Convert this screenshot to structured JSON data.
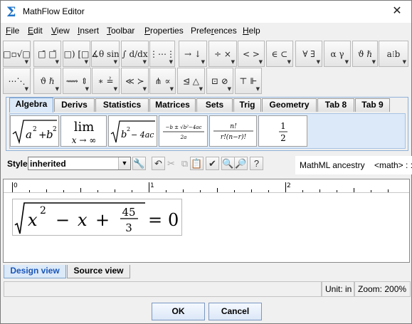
{
  "window": {
    "title": "MathFlow Editor",
    "close_glyph": "✕",
    "app_icon_glyph": "Σ"
  },
  "menu": [
    {
      "pre": "",
      "u": "F",
      "post": "ile"
    },
    {
      "pre": "",
      "u": "E",
      "post": "dit"
    },
    {
      "pre": "",
      "u": "V",
      "post": "iew"
    },
    {
      "pre": "",
      "u": "I",
      "post": "nsert"
    },
    {
      "pre": "",
      "u": "T",
      "post": "oolbar"
    },
    {
      "pre": "",
      "u": "P",
      "post": "roperties"
    },
    {
      "pre": "Prefe",
      "u": "r",
      "post": "ences"
    },
    {
      "pre": "",
      "u": "H",
      "post": "elp"
    }
  ],
  "toolbar_row1": [
    {
      "icon": "script-radical-template-icon",
      "glyph": "□▫√□"
    },
    {
      "icon": "overscript-template-icon",
      "glyph": "□̄ □̃"
    },
    {
      "icon": "fenced-template-icon",
      "glyph": "(□) [□]"
    },
    {
      "icon": "angle-trig-icon",
      "glyph": "∡θ sin"
    },
    {
      "icon": "calculus-icon",
      "glyph": "∫ d/dx"
    },
    {
      "icon": "matrix-template-icon",
      "glyph": "⋮⋯⋮"
    },
    {
      "icon": "arrows-icon",
      "glyph": "→ ↓"
    },
    {
      "icon": "operators-icon",
      "glyph": "÷ ×"
    },
    {
      "icon": "relations-icon",
      "glyph": "< >"
    },
    {
      "icon": "set-operators-icon",
      "glyph": "∈ ⊂"
    },
    {
      "icon": "logic-icon",
      "glyph": "∀ ∃"
    },
    {
      "icon": "greek-icon",
      "glyph": "α γ"
    },
    {
      "icon": "variant-greek-icon",
      "glyph": "ϑ ℏ"
    },
    {
      "icon": "spacing-icon",
      "glyph": "a⁝b"
    }
  ],
  "toolbar_row2": [
    {
      "icon": "dots-icon",
      "glyph": "⋯⋱"
    },
    {
      "icon": "symbols-icon",
      "glyph": "ϑ ℏ"
    },
    {
      "icon": "stretchy-arrows-icon",
      "glyph": "⟿ ⇕"
    },
    {
      "icon": "misc-operators-icon",
      "glyph": "∗ ≟"
    },
    {
      "icon": "comparison-icon",
      "glyph": "≪ ≻"
    },
    {
      "icon": "binary-relations-icon",
      "glyph": "⋔ ∝"
    },
    {
      "icon": "triangle-relations-icon",
      "glyph": "⊴ △"
    },
    {
      "icon": "boxed-operators-icon",
      "glyph": "⊡ ⊘"
    },
    {
      "icon": "tack-icon",
      "glyph": "⊤ ⊩"
    }
  ],
  "palette_tabs": [
    "Algebra",
    "Derivs",
    "Statistics",
    "Matrices",
    "Sets",
    "Trig",
    "Geometry",
    "Tab 8",
    "Tab 9"
  ],
  "palette_items": {
    "sqrt_sum": {
      "a": "a",
      "sup": "2",
      "op": "+",
      "b": "b",
      "sup2": "2"
    },
    "limit": {
      "lim": "lim",
      "sub": "x → ∞"
    },
    "discriminant": {
      "b": "b",
      "sup": "2",
      "rest": "− 4ac"
    },
    "quadratic": {
      "num": "−b ± √b²−4ac",
      "den": "2a"
    },
    "combination": {
      "num": "n!",
      "den": "r!(n−r)!"
    },
    "half": {
      "num": "1",
      "den": "2"
    }
  },
  "style": {
    "label": "Style:",
    "value": "inherited",
    "arrow": "▼"
  },
  "style_buttons": [
    {
      "name": "wrench-icon",
      "glyph": "🔧",
      "state": "framed"
    },
    {
      "name": "undo-icon",
      "glyph": "↶",
      "state": "framed"
    },
    {
      "name": "cut-icon",
      "glyph": "✂",
      "state": "disabled"
    },
    {
      "name": "copy-icon",
      "glyph": "⧉",
      "state": "disabled"
    },
    {
      "name": "paste-icon",
      "glyph": "📋",
      "state": "framed"
    },
    {
      "name": "check-icon",
      "glyph": "✔",
      "state": "framed"
    },
    {
      "name": "find-icon",
      "glyph": "🔍",
      "state": "framed"
    },
    {
      "name": "replace-icon",
      "glyph": "🔎",
      "state": "framed"
    },
    {
      "name": "help-icon",
      "glyph": "?",
      "state": "framed"
    }
  ],
  "ancestry": {
    "label": "MathML ancestry",
    "path": "<math> : :"
  },
  "ruler": {
    "marks": [
      "0",
      "1",
      "2"
    ]
  },
  "equation": {
    "x": "x",
    "exp": "2",
    "minus": "−",
    "x2": "x",
    "plus": "+",
    "num": "45",
    "den": "3",
    "eq": "=",
    "rhs": "0"
  },
  "view_tabs": [
    "Design view",
    "Source view"
  ],
  "status": {
    "unit": "Unit: in",
    "zoom": "Zoom: 200%"
  },
  "buttons": {
    "ok": "OK",
    "cancel": "Cancel"
  }
}
